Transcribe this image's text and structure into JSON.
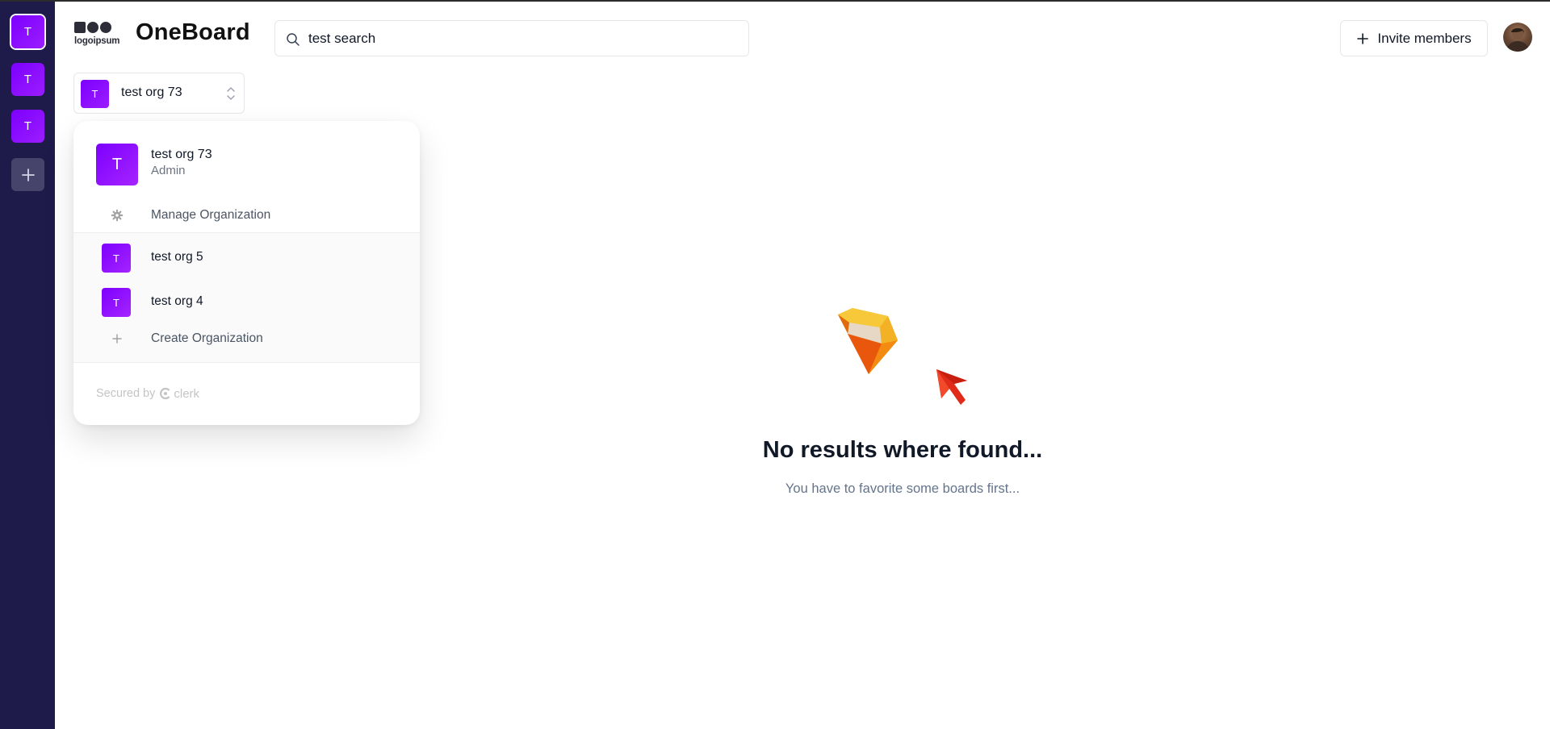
{
  "rail": {
    "orgs": [
      {
        "initial": "T"
      },
      {
        "initial": "T"
      },
      {
        "initial": "T"
      }
    ],
    "add_icon": "plus-icon"
  },
  "header": {
    "logo_text": "logoipsum",
    "brand": "OneBoard",
    "search": {
      "value": "test search",
      "icon": "search-icon"
    },
    "invite_label": "Invite members"
  },
  "switcher": {
    "initial": "T",
    "current_org": "test org 73",
    "icon": "chevrons-up-down-icon"
  },
  "dropdown": {
    "active": {
      "initial": "T",
      "name": "test org 73",
      "role": "Admin"
    },
    "manage_label": "Manage Organization",
    "orgs": [
      {
        "initial": "T",
        "name": "test org 5"
      },
      {
        "initial": "T",
        "name": "test org 4"
      }
    ],
    "create_label": "Create Organization",
    "footer": {
      "secured_by": "Secured by",
      "provider": "clerk"
    }
  },
  "empty_state": {
    "title": "No results where found...",
    "subtitle": "You have to favorite some boards first..."
  },
  "colors": {
    "rail_bg": "#1e1b4b",
    "org_badge": "#7c00ff",
    "muted_text": "#64748b"
  }
}
